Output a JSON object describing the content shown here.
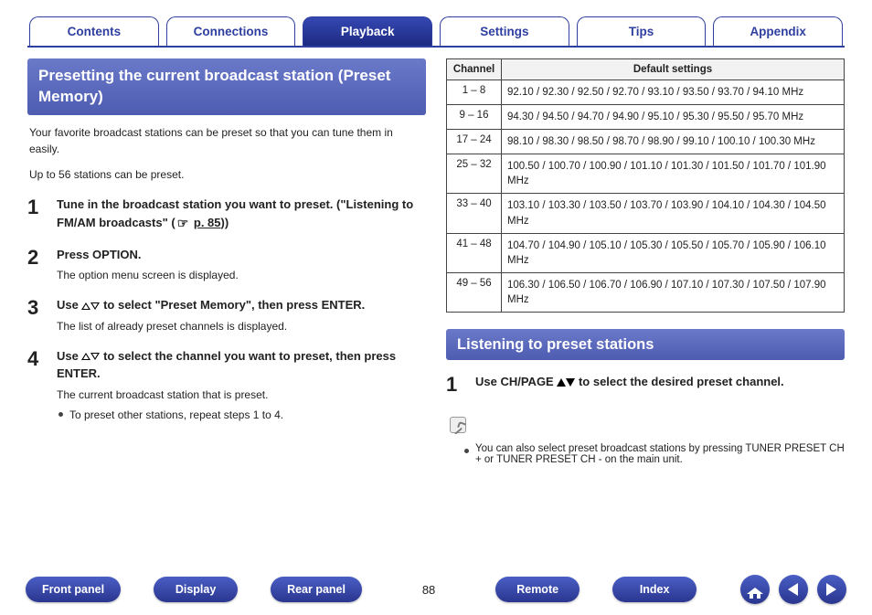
{
  "tabs": [
    "Contents",
    "Connections",
    "Playback",
    "Settings",
    "Tips",
    "Appendix"
  ],
  "active_tab": 2,
  "left": {
    "heading": "Presetting the current broadcast station (Preset Memory)",
    "intro1": "Your favorite broadcast stations can be preset so that you can tune them in easily.",
    "intro2": "Up to 56 stations can be preset.",
    "steps": [
      {
        "n": "1",
        "title_a": "Tune in the broadcast station you want to preset. (\"Listening to FM/AM broadcasts\" (",
        "title_link": "p. 85",
        "title_b": "))",
        "sub": ""
      },
      {
        "n": "2",
        "title_a": "Press OPTION.",
        "sub": "The option menu screen is displayed."
      },
      {
        "n": "3",
        "title_a": "Use ",
        "title_mid": " to select \"Preset Memory\", then press ENTER.",
        "sub": "The list of already preset channels is displayed."
      },
      {
        "n": "4",
        "title_a": "Use ",
        "title_mid": " to select the channel you want to preset, then press ENTER.",
        "sub": "The current broadcast station that is preset.",
        "bullet": "To preset other stations, repeat steps 1 to 4."
      }
    ]
  },
  "table": {
    "head_channel": "Channel",
    "head_default": "Default settings",
    "rows": [
      {
        "ch": "1 – 8",
        "val": "92.10 / 92.30 / 92.50 / 92.70 / 93.10 / 93.50 / 93.70 / 94.10 MHz"
      },
      {
        "ch": "9 – 16",
        "val": "94.30 / 94.50 / 94.70 / 94.90 / 95.10 / 95.30 / 95.50 / 95.70 MHz"
      },
      {
        "ch": "17 – 24",
        "val": "98.10 / 98.30 / 98.50 / 98.70 / 98.90 / 99.10 / 100.10 / 100.30 MHz"
      },
      {
        "ch": "25 – 32",
        "val": "100.50 / 100.70 / 100.90 / 101.10 / 101.30 / 101.50 / 101.70 / 101.90 MHz"
      },
      {
        "ch": "33 – 40",
        "val": "103.10 / 103.30 / 103.50 / 103.70 / 103.90 / 104.10 / 104.30 / 104.50 MHz"
      },
      {
        "ch": "41 – 48",
        "val": "104.70 / 104.90 / 105.10 / 105.30 / 105.50 / 105.70 / 105.90 / 106.10 MHz"
      },
      {
        "ch": "49 – 56",
        "val": "106.30 / 106.50 / 106.70 / 106.90 / 107.10 / 107.30 / 107.50 / 107.90 MHz"
      }
    ]
  },
  "right": {
    "heading": "Listening to preset stations",
    "step_n": "1",
    "step_a": "Use CH/PAGE ",
    "step_b": " to select the desired preset channel.",
    "note_bullet": "You can also select preset broadcast stations by pressing TUNER PRESET CH + or TUNER PRESET CH - on the main unit."
  },
  "footer": {
    "pills_left": [
      "Front panel",
      "Display",
      "Rear panel"
    ],
    "page_num": "88",
    "pills_right": [
      "Remote",
      "Index"
    ]
  }
}
